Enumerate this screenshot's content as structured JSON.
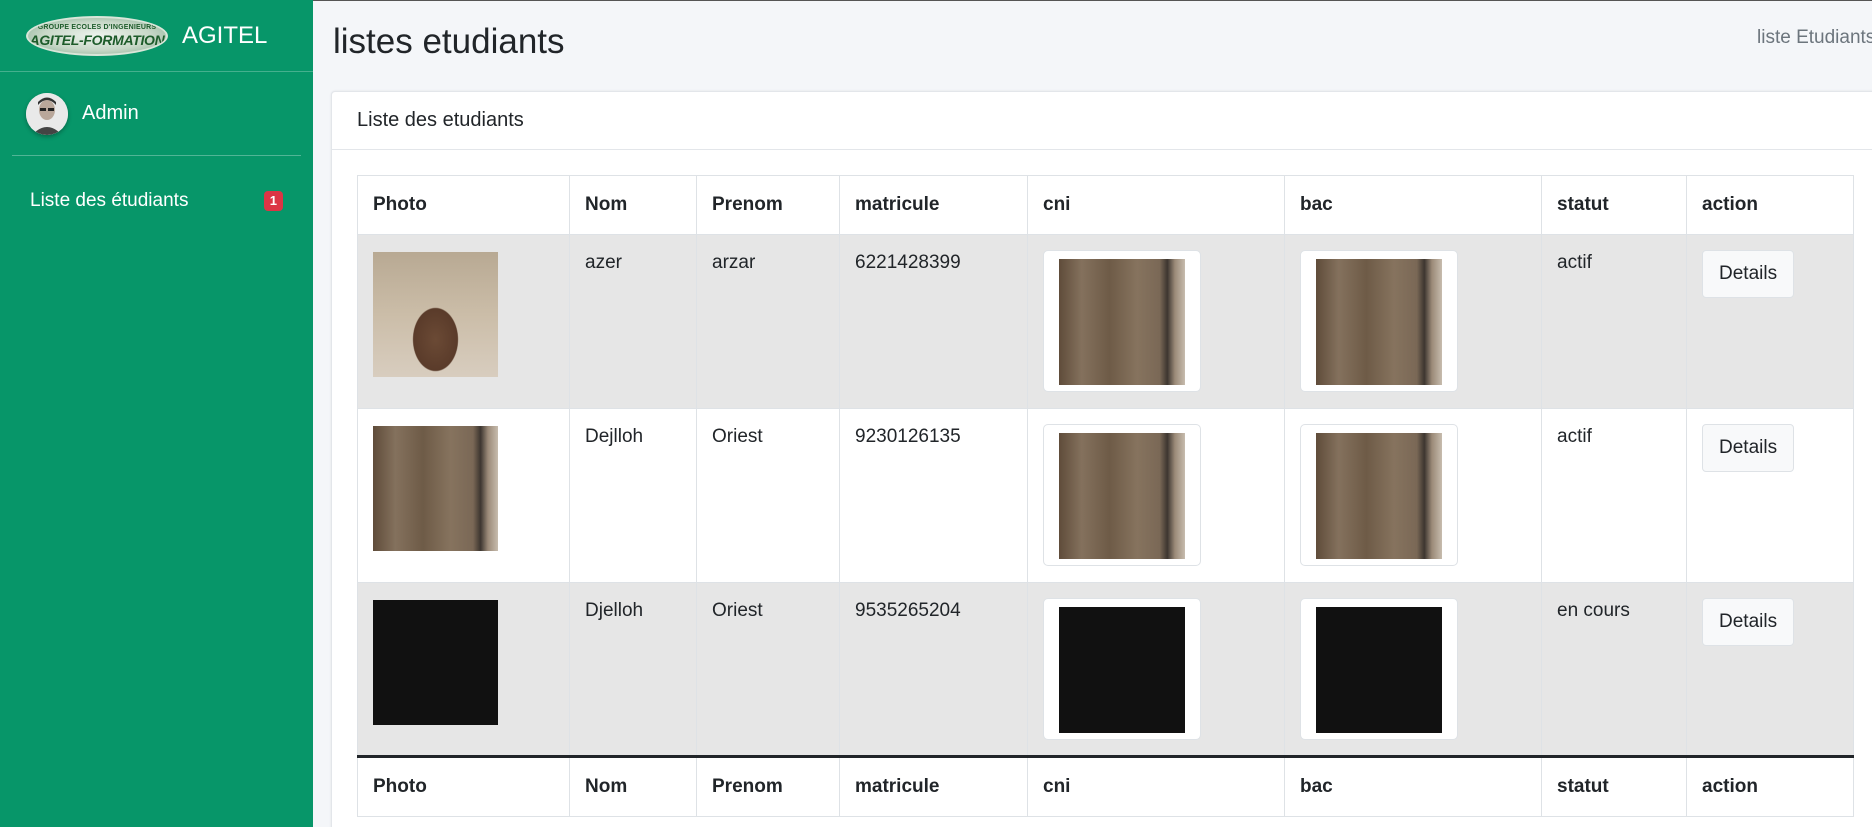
{
  "sidebar": {
    "brand_logo_top": "GROUPE ECOLES D'INGENIEURS",
    "brand_logo_main": "AGITEL-FORMATION",
    "brand_name": "AGITEL",
    "user_name": "Admin",
    "nav": [
      {
        "label": "Liste des étudiants",
        "badge": "1"
      }
    ]
  },
  "header": {
    "title": "listes etudiants",
    "breadcrumb": "liste Etudiants"
  },
  "card": {
    "title": "Liste des etudiants"
  },
  "table": {
    "columns": [
      "Photo",
      "Nom",
      "Prenom",
      "matricule",
      "cni",
      "bac",
      "statut",
      "action"
    ],
    "rows": [
      {
        "nom": "azer",
        "prenom": "arzar",
        "matricule": "6221428399",
        "statut": "actif",
        "action": "Details",
        "photo": "pillow-photo",
        "cni": "room-photo",
        "bac": "room-photo"
      },
      {
        "nom": "Dejlloh",
        "prenom": "Oriest",
        "matricule": "9230126135",
        "statut": "actif",
        "action": "Details",
        "photo": "room-photo",
        "cni": "room-photo",
        "bac": "room-photo"
      },
      {
        "nom": "Djelloh",
        "prenom": "Oriest",
        "matricule": "9535265204",
        "statut": "en cours",
        "action": "Details",
        "photo": "black-image",
        "cni": "black-image",
        "bac": "black-image"
      }
    ]
  },
  "colors": {
    "sidebar_bg": "#079669",
    "badge": "#dc3545",
    "stripe": "#e6e6e6"
  }
}
